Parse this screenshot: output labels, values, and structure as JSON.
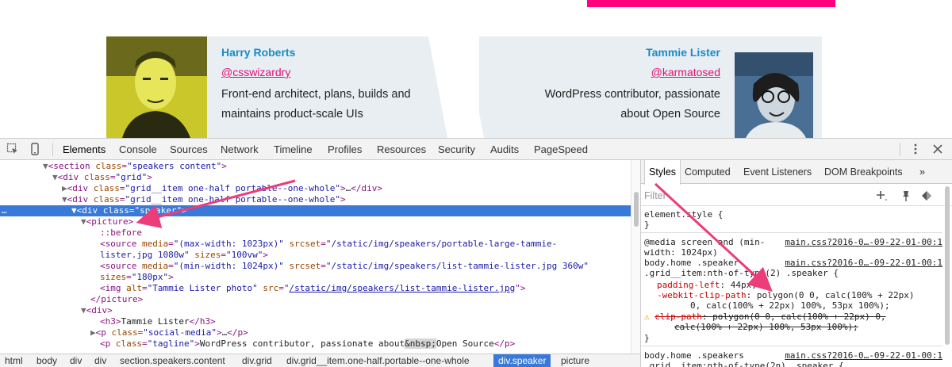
{
  "page": {
    "speaker_left": {
      "name": "Harry Roberts",
      "handle": "@csswizardry",
      "tagline_line1": "Front-end architect, plans, builds and",
      "tagline_line2": "maintains product-scale UIs"
    },
    "speaker_right": {
      "name": "Tammie Lister",
      "handle": "@karmatosed",
      "tagline_line1": "WordPress contributor, passionate",
      "tagline_line2": "about Open Source"
    },
    "accent_pink": "#ff007f",
    "accent_blue": "#1a8bc9"
  },
  "devtools": {
    "tabs": [
      "Elements",
      "Console",
      "Sources",
      "Network",
      "Timeline",
      "Profiles",
      "Resources",
      "Security",
      "Audits",
      "PageSpeed"
    ],
    "active_tab": "Elements",
    "dom": {
      "l0_tag": "section",
      "l0_attr": "class",
      "l0_val": "\"speakers content\"",
      "l1_tag": "div",
      "l1_attr": "class",
      "l1_val": "\"grid\"",
      "l2_tag": "div",
      "l2_attr": "class",
      "l2_val": "\"grid__item one-half portable--one-whole\"",
      "l2_ellipsis": "…",
      "l3_tag": "div",
      "l3_attr": "class",
      "l3_val": "\"grid__item one-half portable--one-whole\"",
      "l4_tag": "div",
      "l4_attr": "class",
      "l4_val": "\"speaker\"",
      "l5_tag": "picture",
      "l6_pseudo": "::before",
      "l7_tag": "source",
      "l7_a1": "media",
      "l7_v1": "\"(max-width: 1023px)\"",
      "l7_a2": "srcset",
      "l7_v2": "\"/static/img/speakers/portable-large-tammie-",
      "l8_v2": "lister.jpg 1080w\"",
      "l8_a3": "sizes",
      "l8_v3": "\"100vw\"",
      "l9_tag": "source",
      "l9_a1": "media",
      "l9_v1": "\"(min-width: 1024px)\"",
      "l9_a2": "srcset",
      "l9_v2": "\"/static/img/speakers/list-tammie-lister.jpg 360w\"",
      "l10_a3": "sizes",
      "l10_v3": "\"180px\"",
      "l11_tag": "img",
      "l11_a1": "alt",
      "l11_v1": "\"Tammie Lister photo\"",
      "l11_a2": "src",
      "l11_v2": "/static/img/speakers/list-tammie-lister.jpg",
      "l12_tag": "picture",
      "l13_tag": "div",
      "l14_tag": "h3",
      "l14_text": "Tammie Lister",
      "l15_tag": "p",
      "l15_attr": "class",
      "l15_val": "\"social-media\"",
      "l15_ellipsis": "…",
      "l16_tag": "p",
      "l16_attr": "class",
      "l16_val": "\"tagline\"",
      "l16_text": "WordPress contributor, passionate about",
      "l16_nbsp": "&nbsp;",
      "l16_text2": "Open Source"
    },
    "breadcrumbs": [
      "html",
      "body",
      "div",
      "div",
      "section.speakers.content",
      "div.grid",
      "div.grid__item.one-half.portable--one-whole",
      "div.speaker",
      "picture"
    ],
    "active_crumb": "div.speaker",
    "styles_tabs": [
      "Styles",
      "Computed",
      "Event Listeners",
      "DOM Breakpoints"
    ],
    "active_styles_tab": "Styles",
    "filter_placeholder": "Filter",
    "css": {
      "element_style": "element.style {",
      "close": "}",
      "rule1_media": "@media screen and (min-",
      "rule1_media2": "width: 1024px)",
      "rule1_sel1": "body.home .speaker",
      "rule1_sel2": ".grid__item:nth-of-type(2) .speaker {",
      "rule1_src1": "main.css?2016-0…-09-22-01-00:1",
      "rule1_src2": "main.css?2016-0…-09-22-01-00:1",
      "p1_name": "padding-left",
      "p1_val": "44px;",
      "p2_name": "-webkit-clip-path",
      "p2_val": "polygon(0 0, calc(100% + 22px)",
      "p2_val2": "0, calc(100% + 22px) 100%, 53px 100%);",
      "p3_name": "clip-path",
      "p3_val": "polygon(0 0, calc(100% + 22px) 0,",
      "p3_val2": "calc(100% + 22px) 100%, 53px 100%);",
      "rule2_sel1": "body.home .speakers",
      "rule2_sel2": ".grid__item:nth-of-type(2n) .speaker {",
      "rule2_src": "main.css?2016-0…-09-22-01-00:1"
    }
  }
}
